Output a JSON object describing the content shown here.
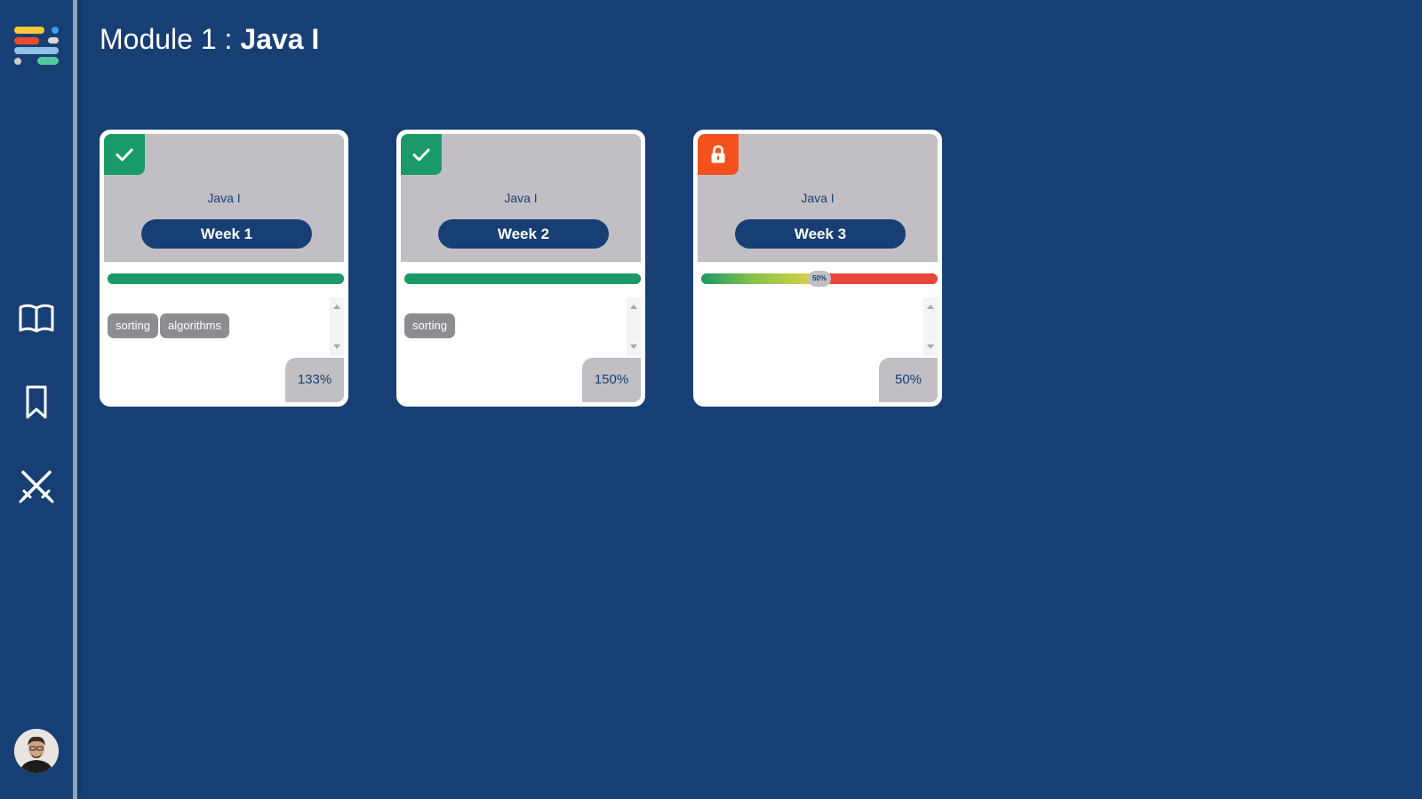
{
  "app": {
    "logo_icon": "logo-icon",
    "nav": [
      {
        "id": "courses",
        "icon": "open-book-icon"
      },
      {
        "id": "bookmarks",
        "icon": "bookmark-icon"
      },
      {
        "id": "challenges",
        "icon": "crossed-swords-icon"
      }
    ],
    "avatar_icon": "user-avatar"
  },
  "header": {
    "module_prefix": "Module 1 : ",
    "module_name": "Java I"
  },
  "colors": {
    "background": "#173f74",
    "card_head": "#c1bfc3",
    "done": "#1a9a68",
    "locked": "#f4511e",
    "progress_remaining": "#e8463a",
    "tag": "#8e8c90"
  },
  "cards": [
    {
      "status": "completed",
      "status_icon": "checkmark-icon",
      "course": "Java I",
      "week_label": "Week 1",
      "progress": 1.0,
      "tags": [
        "sorting",
        "algorithms"
      ],
      "score": "133%"
    },
    {
      "status": "completed",
      "status_icon": "checkmark-icon",
      "course": "Java I",
      "week_label": "Week 2",
      "progress": 1.0,
      "tags": [
        "sorting"
      ],
      "score": "150%"
    },
    {
      "status": "locked",
      "status_icon": "lock-icon",
      "course": "Java I",
      "week_label": "Week 3",
      "progress": 0.5,
      "progress_label": "50%",
      "tags": [],
      "score": "50%"
    }
  ]
}
